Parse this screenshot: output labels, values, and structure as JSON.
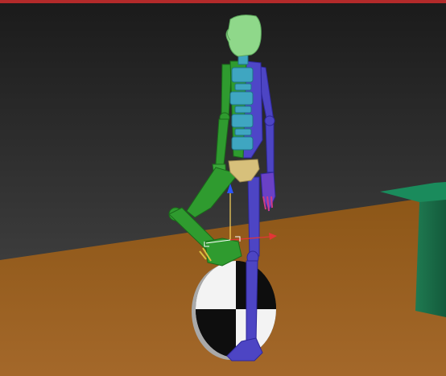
{
  "viewport": {
    "active_border_color": "#b32a2a",
    "background_top": "#1f1f1f",
    "background_bottom": "#4a4a4a",
    "floor_color": "#9a5e1e",
    "box_color": "#1a6e48"
  },
  "scene": {
    "objects": [
      {
        "name": "biped-head",
        "color": "#8fd88a"
      },
      {
        "name": "biped-spine",
        "color": "#3fa6c1"
      },
      {
        "name": "biped-left-limbs",
        "color": "#2f9b2f"
      },
      {
        "name": "biped-right-limbs",
        "color": "#4d45c4"
      },
      {
        "name": "biped-pelvis",
        "color": "#d7c07b"
      },
      {
        "name": "unicycle-wheel",
        "color": "#101010"
      },
      {
        "name": "green-box",
        "color": "#1a6e48"
      }
    ],
    "gizmo": {
      "x_axis_color": "#e33636",
      "y_axis_color": "#2b55ff",
      "z_axis_color": "#ffd65a"
    }
  }
}
